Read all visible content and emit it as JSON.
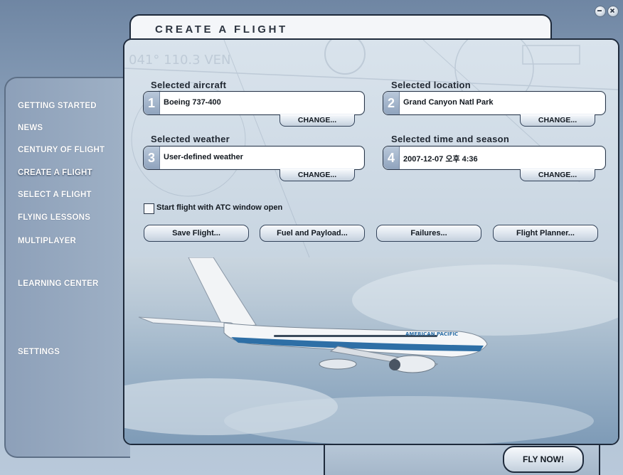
{
  "window": {
    "minimize_icon": "minimize-icon",
    "close_icon": "close-icon"
  },
  "title": "CREATE A FLIGHT",
  "nav": {
    "items": [
      {
        "label": "GETTING STARTED"
      },
      {
        "label": "NEWS"
      },
      {
        "label": "CENTURY OF FLIGHT"
      },
      {
        "label": "CREATE A FLIGHT"
      },
      {
        "label": "SELECT A FLIGHT"
      },
      {
        "label": "FLYING LESSONS"
      },
      {
        "label": "MULTIPLAYER"
      },
      {
        "label": "LEARNING CENTER"
      },
      {
        "label": "SETTINGS"
      }
    ],
    "active": "CREATE A FLIGHT"
  },
  "background_map_text": "041° 110.3 VEN",
  "sections": {
    "aircraft": {
      "label": "Selected aircraft",
      "number": "1",
      "value": "Boeing 737-400",
      "button": "CHANGE..."
    },
    "location": {
      "label": "Selected location",
      "number": "2",
      "value": "Grand Canyon Natl Park",
      "button": "CHANGE..."
    },
    "weather": {
      "label": "Selected weather",
      "number": "3",
      "value": "User-defined weather",
      "button": "CHANGE..."
    },
    "time": {
      "label": "Selected time and season",
      "number": "4",
      "value": "2007-12-07 오후 4:36",
      "button": "CHANGE..."
    }
  },
  "atc_checkbox": {
    "label": "Start flight with ATC window open",
    "checked": false
  },
  "actions": {
    "save": "Save Flight...",
    "fuel": "Fuel and Payload...",
    "failures": "Failures...",
    "planner": "Flight Planner..."
  },
  "fly_now": "FLY NOW!",
  "aircraft_livery_text": "AMERICAN PACIFIC",
  "colors": {
    "accent_dark": "#1e2a3b",
    "panel_light": "#d9e3ec",
    "livery_blue": "#2e6fa6",
    "badge": "#9fb2c8"
  }
}
